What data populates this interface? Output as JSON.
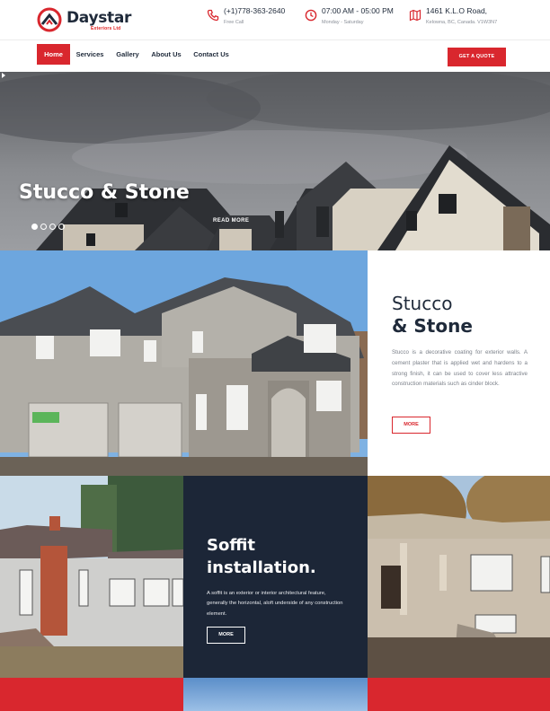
{
  "brand": {
    "name": "Daystar",
    "tagline": "Exteriors Ltd",
    "accent_color": "#d9272e",
    "dark_color": "#1c2637"
  },
  "contact": {
    "phone": {
      "icon": "phone-icon",
      "main": "(+1)778-363-2640",
      "sub": "Free Call"
    },
    "hours": {
      "icon": "clock-icon",
      "main": "07:00 AM - 05:00 PM",
      "sub": "Monday - Saturday"
    },
    "address": {
      "icon": "map-icon",
      "main": "1461 K.L.O Road,",
      "sub": "Kelowna, BC, Canada. V1W3N7"
    }
  },
  "nav": {
    "items": [
      {
        "label": "Home",
        "active": true
      },
      {
        "label": "Services",
        "active": false
      },
      {
        "label": "Gallery",
        "active": false
      },
      {
        "label": "About Us",
        "active": false
      },
      {
        "label": "Contact Us",
        "active": false
      }
    ],
    "cta_label": "GET A QUOTE"
  },
  "hero": {
    "title": "Stucco & Stone",
    "read_more_label": "READ MORE",
    "slide_count": 4,
    "active_slide": 1
  },
  "stucco": {
    "title_line1": "Stucco",
    "title_line2": "& Stone",
    "body": "Stucco is a decorative coating for exterior walls. A cement plaster that is applied wet and hardens to a strong finish, it can be used to cover less attractive construction materials such as cinder block.",
    "more_label": "MORE"
  },
  "soffit": {
    "title": "Soffit installation.",
    "body": "A soffit is an exterior or interior architectural feature, generally the horizontal, aloft underside of any construction element.",
    "more_label": "MORE"
  }
}
